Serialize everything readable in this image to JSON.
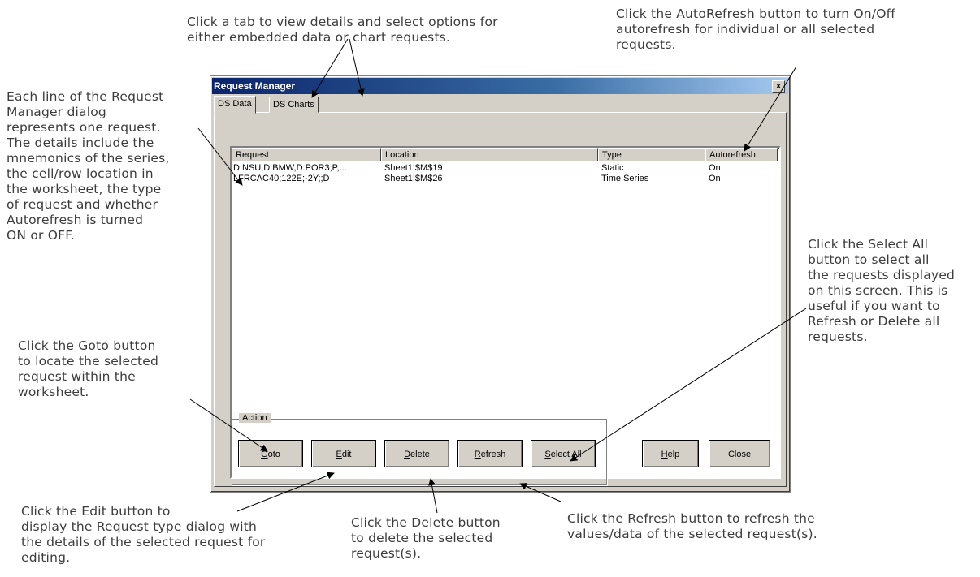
{
  "dialog": {
    "title": "Request Manager",
    "close_glyph": "x",
    "tabs": [
      {
        "label": "DS Data"
      },
      {
        "label": "DS Charts"
      }
    ],
    "table": {
      "columns": [
        "Request",
        "Location",
        "Type",
        "Autorefresh"
      ],
      "rows": [
        {
          "request": "D:NSU,D:BMW,D:POR3;P,...",
          "location": "Sheet1!$M$19",
          "type": "Static",
          "autorefresh": "On"
        },
        {
          "request": "LFRCAC40;122E;-2Y;;D",
          "location": "Sheet1!$M$26",
          "type": "Time Series",
          "autorefresh": "On"
        }
      ]
    },
    "action_group_label": "Action",
    "buttons": {
      "goto": {
        "mnemonic": "G",
        "rest": "oto"
      },
      "edit": {
        "mnemonic": "E",
        "rest": "dit"
      },
      "delete": {
        "mnemonic": "D",
        "rest": "elete"
      },
      "refresh": {
        "mnemonic": "R",
        "rest": "efresh"
      },
      "select_all": {
        "mnemonic": "S",
        "rest": "elect All"
      },
      "help": {
        "mnemonic": "H",
        "rest": "elp"
      },
      "close": {
        "mnemonic": "",
        "rest": "Close"
      }
    }
  },
  "annotations": {
    "tabs": "Click a tab to view details and select options for\neither embedded data or chart  requests.",
    "autorefresh": "Click the AutoRefresh button to turn On/Off\nautorefresh for individual or all selected\nrequests.",
    "lines": "Each line of the Request\nManager dialog\nrepresents one request.\nThe details include the\nmnemonics of the series,\nthe cell/row location in\nthe worksheet, the type\nof request and whether\nAutorefresh  is turned\nON or OFF.",
    "select_all": "Click the Select All\nbutton  to select all\nthe requests displayed\non this screen. This is\nuseful if you want to\nRefresh or Delete all\nrequests.",
    "goto": "Click the Goto button\nto locate the selected\nrequest within the\nworksheet.",
    "edit": "Click the Edit button to\ndisplay the Request type dialog with\nthe details of the selected request  for\nediting.",
    "delete": "Click the Delete button\nto delete the selected\nrequest(s).",
    "refresh": "Click the Refresh button to refresh the\nvalues/data  of the selected request(s)."
  }
}
